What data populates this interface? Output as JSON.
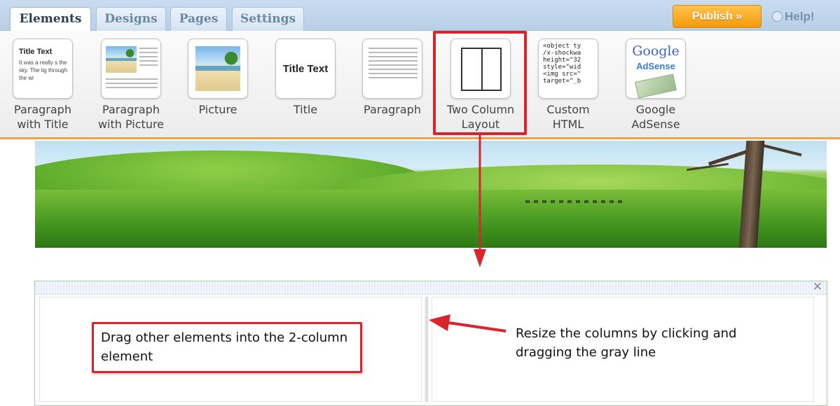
{
  "tabs": [
    {
      "label": "Elements",
      "active": true
    },
    {
      "label": "Designs",
      "active": false
    },
    {
      "label": "Pages",
      "active": false
    },
    {
      "label": "Settings",
      "active": false
    }
  ],
  "header": {
    "publish_label": "Publish »",
    "help_label": "Help!"
  },
  "elements": [
    {
      "label": "Paragraph\nwith Title",
      "icon": "paragraph-with-title-icon",
      "mini_title": "Title Text",
      "mini_text": "It was a really s the sky. The lig through the wi"
    },
    {
      "label": "Paragraph\nwith Picture",
      "icon": "paragraph-with-picture-icon"
    },
    {
      "label": "Picture",
      "icon": "picture-icon"
    },
    {
      "label": "Title",
      "icon": "title-icon",
      "mini_title": "Title Text"
    },
    {
      "label": "Paragraph",
      "icon": "paragraph-icon"
    },
    {
      "label": "Two Column\nLayout",
      "icon": "two-column-layout-icon"
    },
    {
      "label": "Custom\nHTML",
      "icon": "custom-html-icon",
      "code": "<object ty\n/x-shockwa\nheight=\"32\nstyle=\"wid\n<img src=\"\ntarget=\"_b"
    },
    {
      "label": "Google\nAdSense",
      "icon": "google-adsense-icon",
      "logo_word": "Google",
      "logo_sub": "AdSense"
    }
  ],
  "canvas": {
    "callout_left": "Drag other elements into the 2-column element",
    "callout_right": "Resize the columns by clicking and dragging the gray line",
    "close_glyph": "✕"
  },
  "colors": {
    "highlight": "#d8242a",
    "publish": "#f59a0c",
    "accent_line": "#f0a248"
  }
}
